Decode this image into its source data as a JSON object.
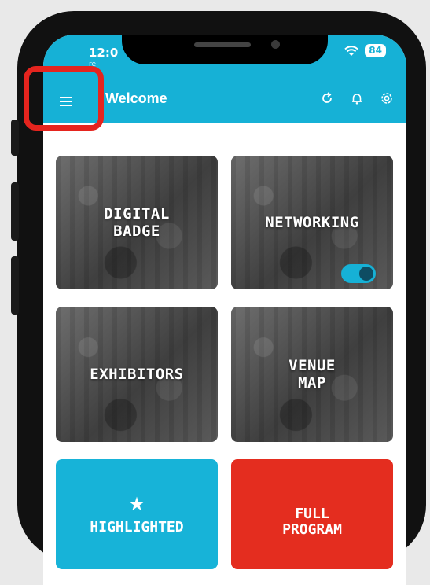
{
  "status_bar": {
    "time": "12:0",
    "carrier": "re",
    "battery": "84"
  },
  "app_bar": {
    "title": "Welcome"
  },
  "tiles": {
    "digital_badge": "DIGITAL\nBADGE",
    "networking": "NETWORKING",
    "exhibitors": "EXHIBITORS",
    "venue_map": "VENUE\nMAP",
    "highlighted": "HIGHLIGHTED",
    "full_program": "FULL\nPROGRAM"
  },
  "colors": {
    "accent": "#16b1d6",
    "red": "#e42d1f",
    "highlight_box": "#e5241e"
  },
  "networking_toggle_on": true
}
